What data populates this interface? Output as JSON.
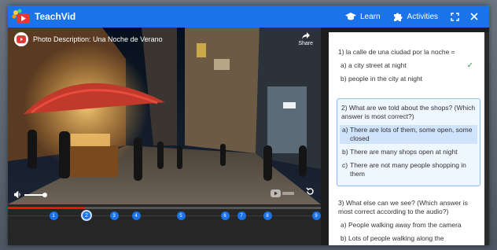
{
  "app": {
    "title": "TeachVid"
  },
  "nav": [
    {
      "label": "Learn",
      "icon": "graduation-cap-icon"
    },
    {
      "label": "Activities",
      "icon": "puzzle-icon"
    }
  ],
  "video": {
    "title": "Photo Description: Una Noche de Verano",
    "share_label": "Share",
    "progress": 0.245,
    "volume": 1.0
  },
  "timeline": {
    "markers": [
      "1",
      "2",
      "3",
      "4",
      "5",
      "6",
      "7",
      "8",
      "9"
    ],
    "active_marker": "2"
  },
  "quiz": {
    "questions": [
      {
        "text": "1) la calle de una ciudad por la noche =",
        "options": [
          {
            "letter": "a)",
            "text": "a city street at night",
            "correct": true
          },
          {
            "letter": "b)",
            "text": "people in the city at night"
          }
        ]
      },
      {
        "text": "2) What are we told about the shops? (Which answer is most correct?)",
        "options": [
          {
            "letter": "a)",
            "text": "There are lots of them, some open, some closed",
            "selected": true
          },
          {
            "letter": "b)",
            "text": "There are many shops open at night"
          },
          {
            "letter": "c)",
            "text": "There are not many people shopping in them"
          }
        ]
      },
      {
        "text": "3) What else can we see? (Which answer is most correct according to the audio?)",
        "options": [
          {
            "letter": "a)",
            "text": "People walking away from the camera"
          },
          {
            "letter": "b)",
            "text": "Lots of people walking along the"
          }
        ]
      }
    ]
  },
  "colors": {
    "accent": "#1a73e8",
    "progress": "#ee1111",
    "correct": "#2da44e",
    "selected_bg": "#cfe3fb"
  }
}
